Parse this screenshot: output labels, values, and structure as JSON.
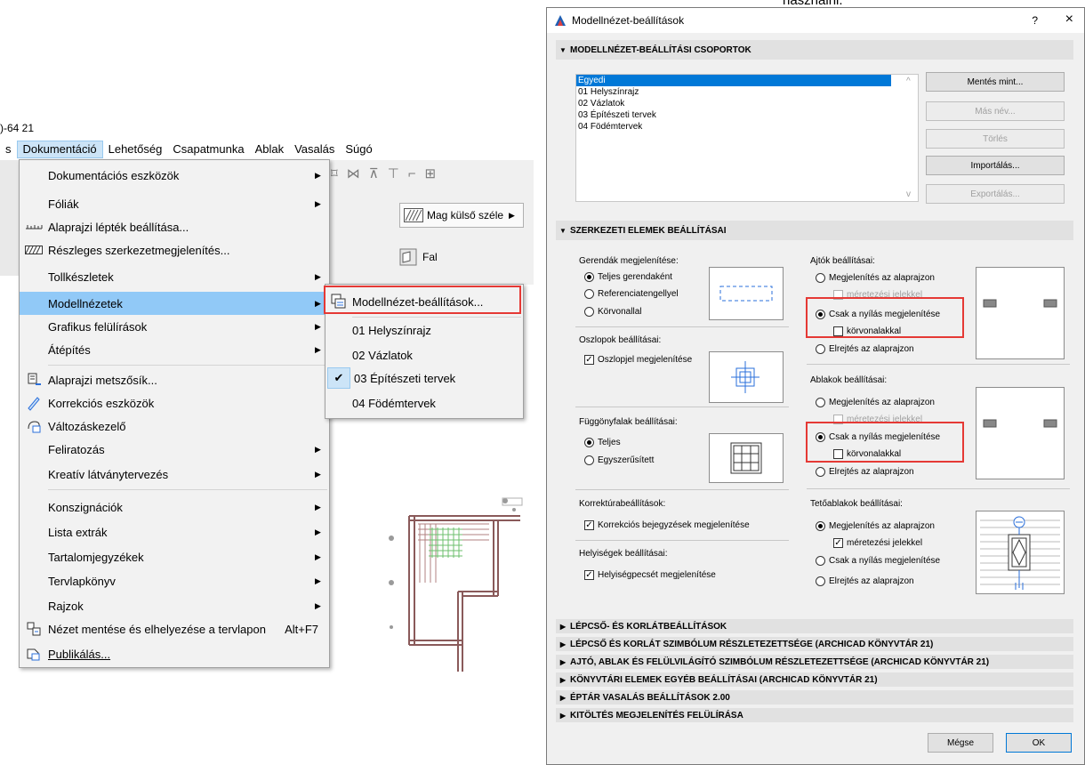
{
  "background_text": {
    "top_fragment": "használni.",
    "title_fragment": ")-64 21"
  },
  "menubar": {
    "items": [
      "s",
      "Dokumentáció",
      "Lehetőség",
      "Csapatmunka",
      "Ablak",
      "Vasalás",
      "Súgó"
    ],
    "active": "Dokumentáció"
  },
  "menu": {
    "items": [
      {
        "label": "Dokumentációs eszközök",
        "submenu": true,
        "icon": "none"
      },
      {
        "label": "Fóliák",
        "submenu": true,
        "icon": "none"
      },
      {
        "label": "Alaprajzi lépték beállítása...",
        "icon": "scale-icon"
      },
      {
        "label": "Részleges szerkezetmegjelenítés...",
        "icon": "hatch-icon"
      },
      {
        "label": "Tollkészletek",
        "submenu": true,
        "icon": "none"
      },
      {
        "label": "Modellnézetek",
        "submenu": true,
        "highlighted": true,
        "icon": "none"
      },
      {
        "label": "Grafikus felülírások",
        "submenu": true,
        "icon": "none"
      },
      {
        "label": "Átépítés",
        "submenu": true,
        "icon": "none"
      },
      {
        "label": "Alaprajzi metszősík...",
        "icon": "cut-plane-icon"
      },
      {
        "label": "Korrekciós eszközök",
        "icon": "markup-icon"
      },
      {
        "label": "Változáskezelő",
        "icon": "change-manager-icon"
      },
      {
        "label": "Feliratozás",
        "submenu": true,
        "icon": "none"
      },
      {
        "label": "Kreatív látványtervezés",
        "submenu": true,
        "icon": "none"
      },
      {
        "label": "Konszignációk",
        "submenu": true,
        "icon": "none"
      },
      {
        "label": "Lista extrák",
        "submenu": true,
        "icon": "none"
      },
      {
        "label": "Tartalomjegyzékek",
        "submenu": true,
        "icon": "none"
      },
      {
        "label": "Tervlapkönyv",
        "submenu": true,
        "icon": "none"
      },
      {
        "label": "Rajzok",
        "submenu": true,
        "icon": "none"
      },
      {
        "label": "Nézet mentése és elhelyezése a tervlapon",
        "accelerator": "Alt+F7",
        "icon": "save-view-icon"
      },
      {
        "label": "Publikálás...",
        "icon": "publish-icon"
      }
    ]
  },
  "submenu": {
    "items": [
      {
        "label": "Modellnézet-beállítások...",
        "icon": "model-view-icon"
      },
      {
        "label": "01 Helyszínrajz"
      },
      {
        "label": "02 Vázlatok"
      },
      {
        "label": "03 Építészeti tervek",
        "checked": true
      },
      {
        "label": "04 Födémtervek"
      }
    ]
  },
  "toolbar": {
    "mag_label": "Mag külső széle",
    "fal_label": "Fal"
  },
  "dialog": {
    "title": "Modellnézet-beállítások",
    "help": "?",
    "close": "×",
    "group_header": "MODELLNÉZET-BEÁLLÍTÁSI CSOPORTOK",
    "list": [
      "Egyedi",
      "01 Helyszínrajz",
      "02 Vázlatok",
      "03 Építészeti tervek",
      "04 Födémtervek"
    ],
    "selected": "Egyedi",
    "buttons": [
      {
        "label": "Mentés mint...",
        "enabled": true
      },
      {
        "label": "Más név...",
        "enabled": false
      },
      {
        "label": "Törlés",
        "enabled": false
      },
      {
        "label": "Importálás...",
        "enabled": true
      },
      {
        "label": "Exportálás...",
        "enabled": false
      }
    ],
    "structural_header": "SZERKEZETI ELEMEK BEÁLLÍTÁSAI",
    "beams": {
      "label": "Gerendák megjelenítése:",
      "options": [
        "Teljes gerendaként",
        "Referenciatengellyel",
        "Körvonallal"
      ],
      "selected": 0
    },
    "columns": {
      "label": "Oszlopok beállításai:",
      "check": "Oszlopjel megjelenítése",
      "checked": true
    },
    "curtain": {
      "label": "Függönyfalak beállításai:",
      "options": [
        "Teljes",
        "Egyszerűsített"
      ],
      "selected": 0
    },
    "markup": {
      "label": "Korrektúrabeállítások:",
      "check": "Korrekciós bejegyzések megjelenítése",
      "checked": true
    },
    "rooms": {
      "label": "Helyiségek beállításai:",
      "check": "Helyiségpecsét megjelenítése",
      "checked": true
    },
    "doors": {
      "label": "Ajtók beállításai:",
      "opt1": "Megjelenítés az alaprajzon",
      "sub1": "méretezési jelekkel",
      "opt2": "Csak a nyílás megjelenítése",
      "sub2": "körvonalakkal",
      "opt3": "Elrejtés az alaprajzon",
      "selected": 1
    },
    "windows": {
      "label": "Ablakok beállításai:",
      "opt1": "Megjelenítés az alaprajzon",
      "sub1": "méretezési jelekkel",
      "opt2": "Csak a nyílás megjelenítése",
      "sub2": "körvonalakkal",
      "opt3": "Elrejtés az alaprajzon",
      "selected": 1
    },
    "skylights": {
      "label": "Tetőablakok beállításai:",
      "opt1": "Megjelenítés az alaprajzon",
      "sub1": "méretezési jelekkel",
      "opt2": "Csak a nyílás megjelenítése",
      "opt3": "Elrejtés az alaprajzon",
      "selected": 0,
      "sub1_checked": true
    },
    "collapsed_sections": [
      "LÉPCSŐ- ÉS KORLÁTBEÁLLÍTÁSOK",
      "LÉPCSŐ ÉS KORLÁT SZIMBÓLUM RÉSZLETEZETTSÉGE (ARCHICAD KÖNYVTÁR 21)",
      "AJTÓ, ABLAK ÉS FELÜLVILÁGÍTÓ SZIMBÓLUM RÉSZLETEZETTSÉGE (ARCHICAD KÖNYVTÁR 21)",
      "KÖNYVTÁRI ELEMEK EGYÉB BEÁLLÍTÁSAI (ARCHICAD KÖNYVTÁR 21)",
      "ÉPTÁR VASALÁS BEÁLLÍTÁSOK 2.00",
      "KITÖLTÉS MEGJELENÍTÉS FELÜLÍRÁSA"
    ],
    "cancel": "Mégse",
    "ok": "OK"
  },
  "colors": {
    "highlight": "#91c9f7",
    "selection": "#0078d7",
    "annotation_red": "#e53935"
  }
}
